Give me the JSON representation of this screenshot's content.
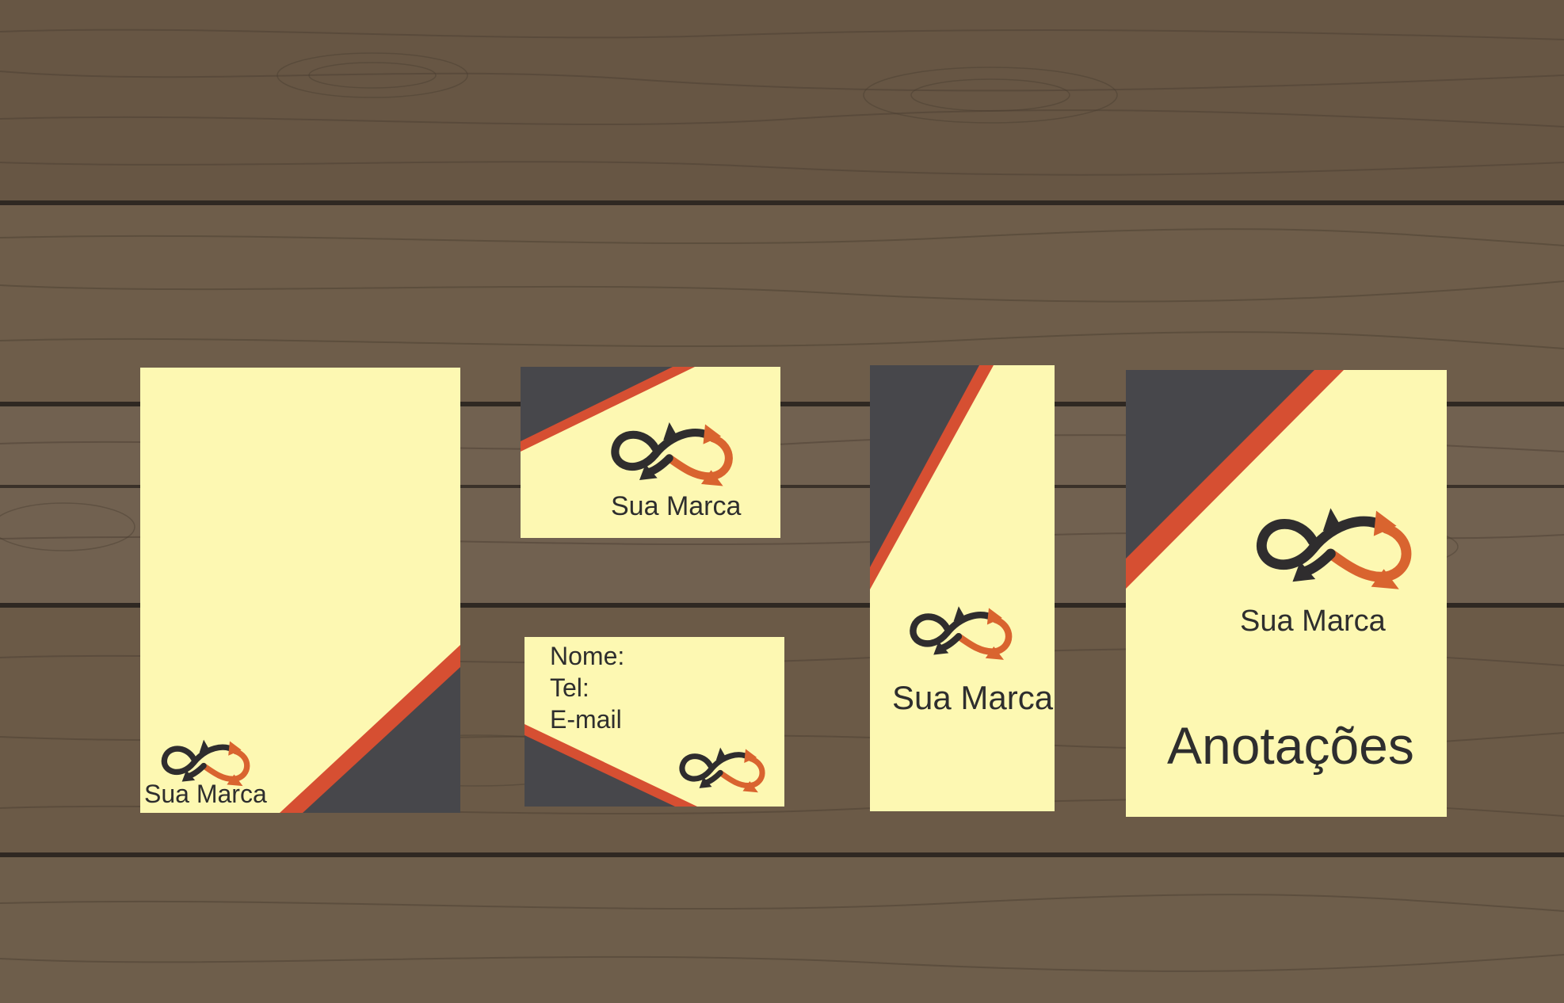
{
  "brand": {
    "name": "Sua Marca",
    "logo_icon": "infinity-arrows-icon"
  },
  "colors": {
    "paper": "#fdf8b2",
    "dark": "#47474b",
    "accent": "#d64f32",
    "logo_dark": "#2f2d2e",
    "logo_orange": "#d9642f",
    "text": "#2e2e2e",
    "wood": "#6a5a48"
  },
  "pieces": {
    "letterhead": {
      "brand_label": "Sua Marca"
    },
    "business_card_front": {
      "brand_label": "Sua Marca"
    },
    "business_card_back": {
      "fields": [
        "Nome:",
        "Tel:",
        "E-mail"
      ]
    },
    "bookmark": {
      "brand_label": "Sua Marca"
    },
    "notebook": {
      "brand_label": "Sua Marca",
      "title": "Anotações"
    }
  }
}
